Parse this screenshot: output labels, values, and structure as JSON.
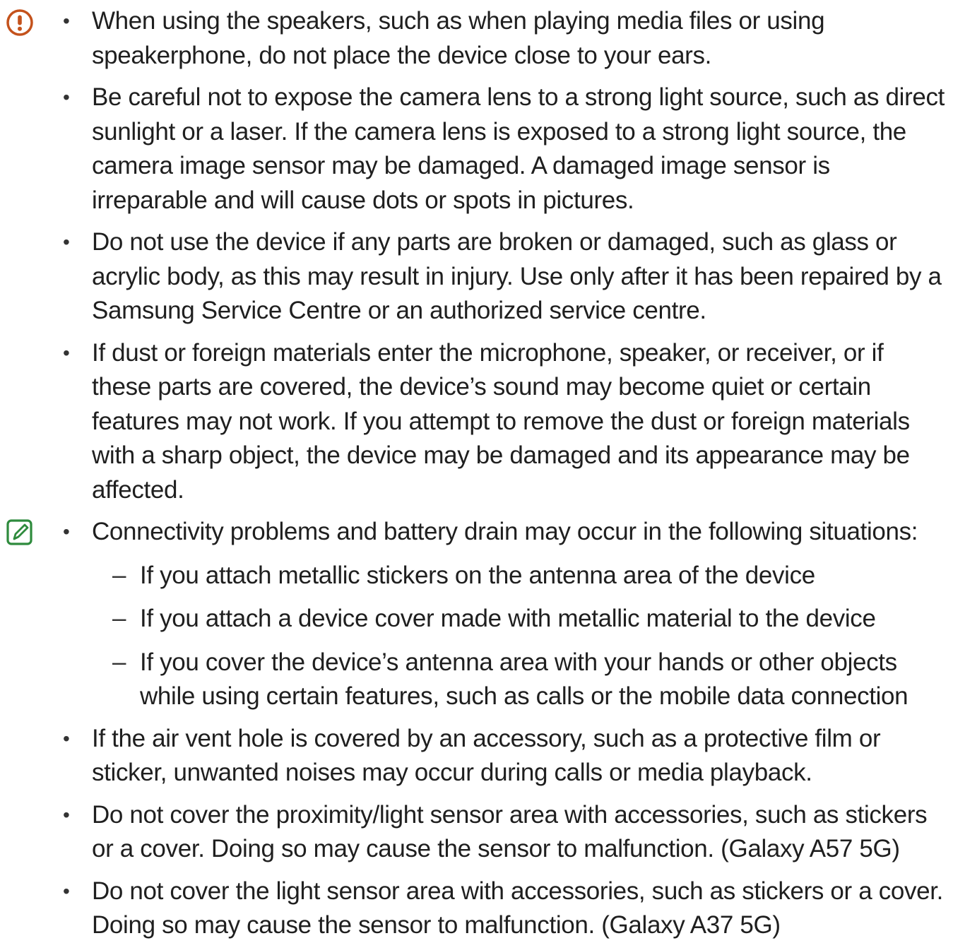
{
  "caution_section": {
    "icon": "exclamation-circle-icon",
    "icon_color": "#c4521c",
    "items": [
      "When using the speakers, such as when playing media files or using speakerphone, do not place the device close to your ears.",
      "Be careful not to expose the camera lens to a strong light source, such as direct sunlight or a laser. If the camera lens is exposed to a strong light source, the camera image sensor may be damaged. A damaged image sensor is irreparable and will cause dots or spots in pictures.",
      "Do not use the device if any parts are broken or damaged, such as glass or acrylic body, as this may result in injury. Use only after it has been repaired by a Samsung Service Centre or an authorized service centre.",
      "If dust or foreign materials enter the microphone, speaker, or receiver, or if these parts are covered, the device’s sound may become quiet or certain features may not work. If you attempt to remove the dust or foreign materials with a sharp object, the device may be damaged and its appearance may be affected."
    ]
  },
  "note_section": {
    "icon": "pencil-note-icon",
    "icon_color": "#2e8b3d",
    "connectivity": {
      "text": "Connectivity problems and battery drain may occur in the following situations:",
      "subitems": [
        "If you attach metallic stickers on the antenna area of the device",
        "If you attach a device cover made with metallic material to the device",
        "If you cover the device’s antenna area with your hands or other objects while using certain features, such as calls or the mobile data connection"
      ]
    },
    "items": [
      "If the air vent hole is covered by an accessory, such as a protective film or sticker, unwanted noises may occur during calls or media playback.",
      "Do not cover the proximity/light sensor area with accessories, such as stickers or a cover. Doing so may cause the sensor to malfunction. (Galaxy A57 5G)",
      "Do not cover the light sensor area with accessories, such as stickers or a cover. Doing so may cause the sensor to malfunction. (Galaxy A37 5G)"
    ]
  },
  "bullet_char": "•",
  "dash_char": "–"
}
